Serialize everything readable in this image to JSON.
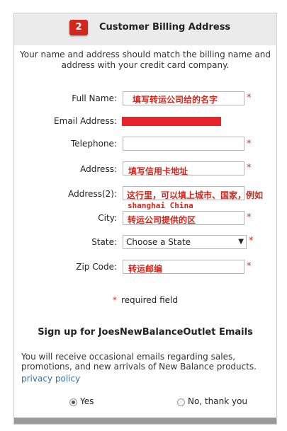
{
  "header": {
    "step_number": "2",
    "title": "Customer Billing Address"
  },
  "intro": "Your name and address should match the billing name and address with your credit card company.",
  "fields": {
    "full_name": {
      "label": "Full Name:",
      "annotation": "填写转运公司给的名字"
    },
    "email": {
      "label": "Email Address:"
    },
    "telephone": {
      "label": "Telephone:"
    },
    "address": {
      "label": "Address:",
      "annotation": "填写信用卡地址"
    },
    "address2": {
      "label": "Address(2):",
      "annotation": "这行里，可以填上城市、国家，例如",
      "annotation2": "shanghai China"
    },
    "city": {
      "label": "City:",
      "annotation": "转运公司提供的区"
    },
    "state": {
      "label": "State:",
      "selected": "Choose a State"
    },
    "zip": {
      "label": "Zip Code:",
      "annotation": "转运邮编"
    }
  },
  "required_star": "*",
  "required_note": {
    "star": "*",
    "text": "required field"
  },
  "signup": {
    "title": "Sign up for JoesNewBalanceOutlet Emails",
    "text": "You will receive occasional emails regarding sales, promotions, and new arrivals of New Balance products.",
    "privacy_link": "privacy policy",
    "options": [
      {
        "label": "Yes",
        "checked": true
      },
      {
        "label": "No, thank you",
        "checked": false
      }
    ]
  },
  "colors": {
    "accent_red": "#d0281c",
    "header_bg": "#ebebeb",
    "link": "#3a6ea5"
  }
}
